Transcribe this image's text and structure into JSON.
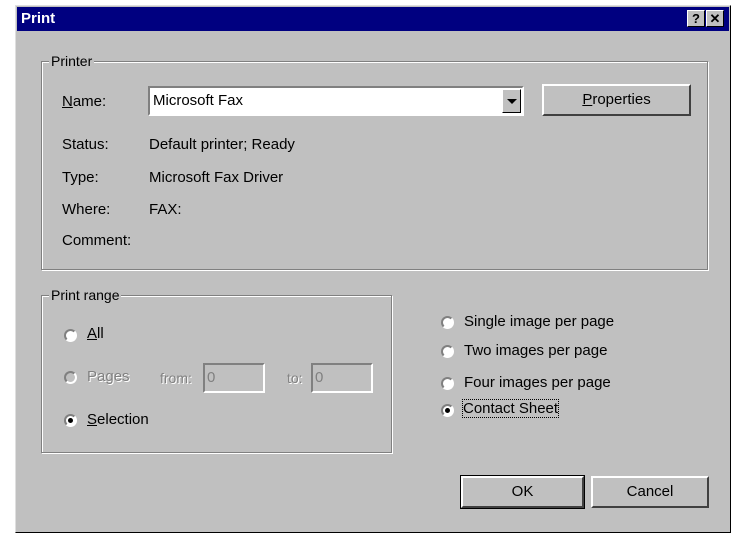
{
  "window": {
    "title": "Print",
    "help_glyph": "?",
    "close_glyph": "✕"
  },
  "printer": {
    "legend": "Printer",
    "name_label": "Name:",
    "name_value": "Microsoft Fax",
    "properties_button": "Properties",
    "status_label": "Status:",
    "status_value": "Default printer; Ready",
    "type_label": "Type:",
    "type_value": "Microsoft Fax Driver",
    "where_label": "Where:",
    "where_value": "FAX:",
    "comment_label": "Comment:",
    "comment_value": ""
  },
  "print_range": {
    "legend": "Print range",
    "all_label": "All",
    "pages_label": "Pages",
    "from_label": "from:",
    "from_value": "0",
    "to_label": "to:",
    "to_value": "0",
    "selection_label": "Selection",
    "selected": "selection"
  },
  "layout_options": {
    "items": [
      {
        "label": "Single image per page",
        "checked": false
      },
      {
        "label": "Two images per page",
        "checked": false
      },
      {
        "label": "Four images per page",
        "checked": false
      },
      {
        "label": "Contact Sheet",
        "checked": true
      }
    ]
  },
  "buttons": {
    "ok": "OK",
    "cancel": "Cancel"
  },
  "colors": {
    "titlebar": "#000080",
    "face": "#c0c0c0"
  }
}
